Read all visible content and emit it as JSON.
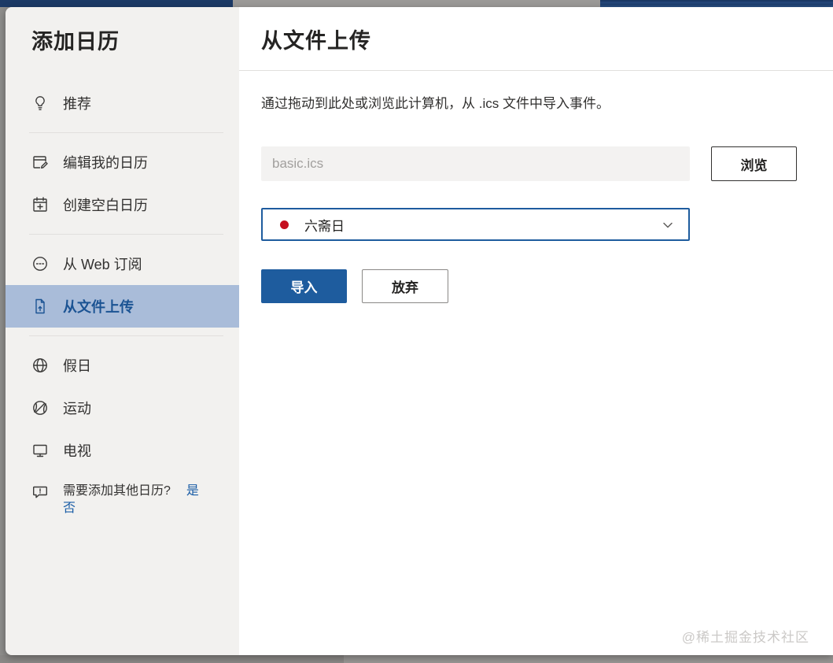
{
  "window": {
    "context": "add-calendar-dialog"
  },
  "sidebar": {
    "title": "添加日历",
    "items": [
      {
        "label": "推荐",
        "icon": "lightbulb-icon",
        "selected": false
      },
      {
        "label": "编辑我的日历",
        "icon": "calendar-edit-icon",
        "selected": false
      },
      {
        "label": "创建空白日历",
        "icon": "calendar-add-icon",
        "selected": false
      },
      {
        "label": "从 Web 订阅",
        "icon": "web-subscribe-icon",
        "selected": false
      },
      {
        "label": "从文件上传",
        "icon": "file-upload-icon",
        "selected": true
      },
      {
        "label": "假日",
        "icon": "globe-icon",
        "selected": false
      },
      {
        "label": "运动",
        "icon": "sports-ball-icon",
        "selected": false
      },
      {
        "label": "电视",
        "icon": "tv-icon",
        "selected": false
      }
    ],
    "feedback": {
      "question": "需要添加其他日历?",
      "yes_label": "是",
      "no_label": "否",
      "icon": "feedback-bubble-icon"
    }
  },
  "main": {
    "title": "从文件上传",
    "description": "通过拖动到此处或浏览此计算机，从 .ics 文件中导入事件。",
    "file_input": {
      "placeholder": "basic.ics",
      "value": ""
    },
    "browse_button": "浏览",
    "calendar_select": {
      "selected_option": "六斋日",
      "dot_color": "#c50f1f",
      "state": "collapsed"
    },
    "import_button": "导入",
    "discard_button": "放弃"
  },
  "watermark": "@稀土掘金技术社区",
  "colors": {
    "accent_blue": "#1e5c9e",
    "selected_item_bg": "#a9bcd9",
    "selected_item_text": "#1b5393",
    "sidebar_bg": "#f2f1ef",
    "input_bg": "#f3f2f1",
    "calendar_dot_red": "#c50f1f",
    "link_blue": "#1a5da6"
  }
}
